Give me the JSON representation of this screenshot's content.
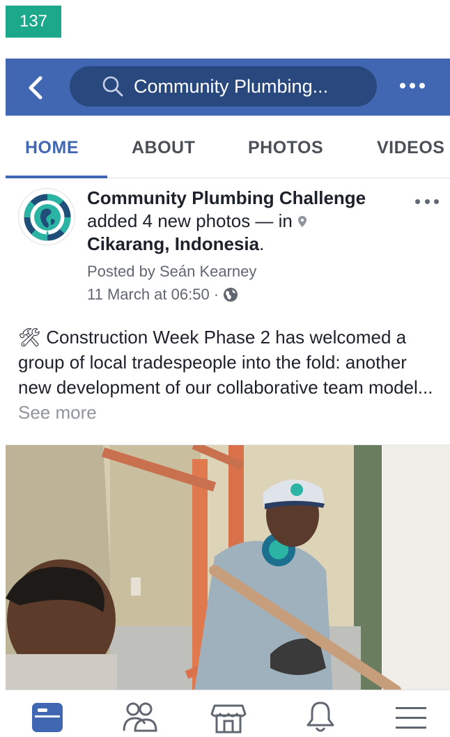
{
  "step_badge": "137",
  "header": {
    "search_text": "Community Plumbing..."
  },
  "tabs": [
    {
      "label": "HOME",
      "active": true
    },
    {
      "label": "ABOUT",
      "active": false
    },
    {
      "label": "PHOTOS",
      "active": false
    },
    {
      "label": "VIDEOS",
      "active": false
    }
  ],
  "post": {
    "page_name": "Community Plumbing Challenge",
    "action_text": "added 4 new photos — in",
    "location": "Cikarang, Indonesia",
    "location_suffix": ".",
    "posted_by": "Posted by Seán Kearney",
    "timestamp": "11 March at 06:50 ·",
    "emoji": "🛠",
    "body": " Construction Week Phase 2 has welcomed a group of local tradespeople into the fold: another new development of our collaborative team model...",
    "see_more": "See more"
  },
  "bottom_nav": [
    {
      "name": "news-feed-icon",
      "active": true
    },
    {
      "name": "friends-icon",
      "active": false
    },
    {
      "name": "marketplace-icon",
      "active": false
    },
    {
      "name": "notifications-icon",
      "active": false
    },
    {
      "name": "menu-icon",
      "active": false
    }
  ],
  "colors": {
    "brand_blue": "#4267b2",
    "search_pill": "#29487d",
    "badge_green": "#1ca88a",
    "muted_text": "#606770"
  }
}
